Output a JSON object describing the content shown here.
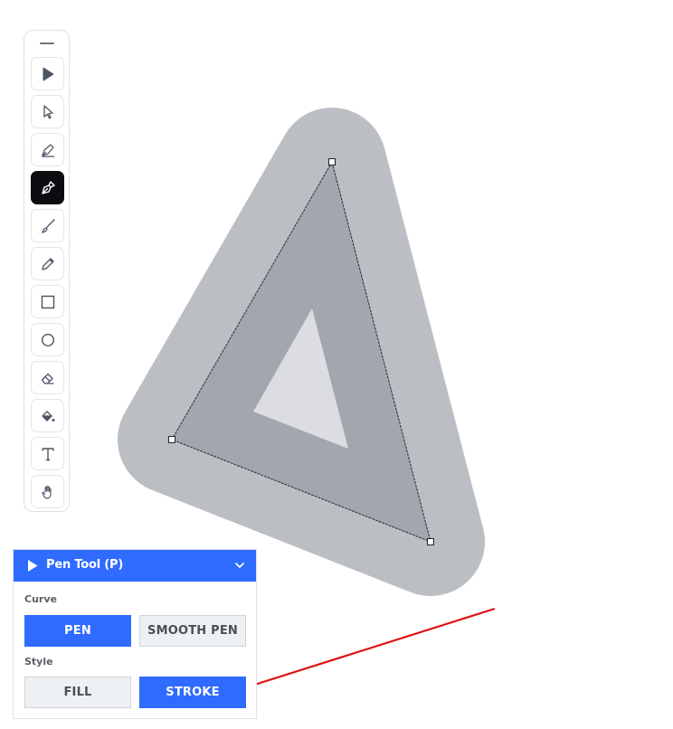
{
  "toolbar": {
    "tools": [
      {
        "id": "select",
        "icon": "filled-cursor-icon",
        "active": false
      },
      {
        "id": "direct-select",
        "icon": "outline-cursor-icon",
        "active": false
      },
      {
        "id": "pen",
        "icon": "pen-nib-icon",
        "active": false
      },
      {
        "id": "pen-tool",
        "icon": "pen-tool-icon",
        "active": true
      },
      {
        "id": "brush",
        "icon": "brush-icon",
        "active": false
      },
      {
        "id": "pencil",
        "icon": "pencil-icon",
        "active": false
      },
      {
        "id": "rectangle",
        "icon": "square-icon",
        "active": false
      },
      {
        "id": "ellipse",
        "icon": "circle-icon",
        "active": false
      },
      {
        "id": "eraser",
        "icon": "eraser-icon",
        "active": false
      },
      {
        "id": "fill",
        "icon": "paint-bucket-icon",
        "active": false
      },
      {
        "id": "text",
        "icon": "text-icon",
        "active": false
      },
      {
        "id": "hand",
        "icon": "hand-icon",
        "active": false
      }
    ]
  },
  "panel": {
    "title": "Pen Tool (P)",
    "curve_label": "Curve",
    "curve_options": [
      "PEN",
      "SMOOTH PEN"
    ],
    "curve_selected": "PEN",
    "style_label": "Style",
    "style_options": [
      "FILL",
      "STROKE"
    ],
    "style_selected": "STROKE"
  },
  "colors": {
    "accent": "#2f6bff",
    "halo": "#bbbec3",
    "stroke_band": "#a2a6ae",
    "inner": "#dcdde0",
    "annotation_arrow": "#e01010"
  }
}
